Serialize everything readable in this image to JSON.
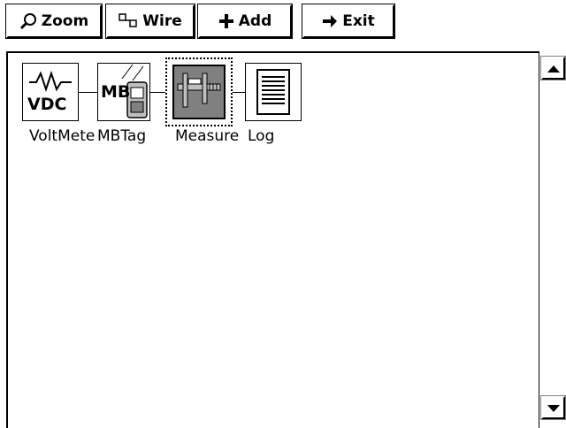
{
  "toolbar": {
    "zoom_label": "Zoom",
    "wire_label": "Wire",
    "add_label": "Add",
    "exit_label": "Exit"
  },
  "nodes": [
    {
      "label": "VoltMete",
      "icon": "sine-wave-vdc-icon",
      "icon_text": "VDC",
      "selected": false
    },
    {
      "label": "MBTag",
      "icon": "mb-tag-device-icon",
      "icon_text": "MB",
      "selected": false
    },
    {
      "label": "Measure",
      "icon": "caliper-icon",
      "selected": true
    },
    {
      "label": "Log",
      "icon": "log-document-icon",
      "selected": false
    }
  ],
  "colors": {
    "background": "#ffffff",
    "border": "#000000",
    "selected_fill": "#808080"
  }
}
